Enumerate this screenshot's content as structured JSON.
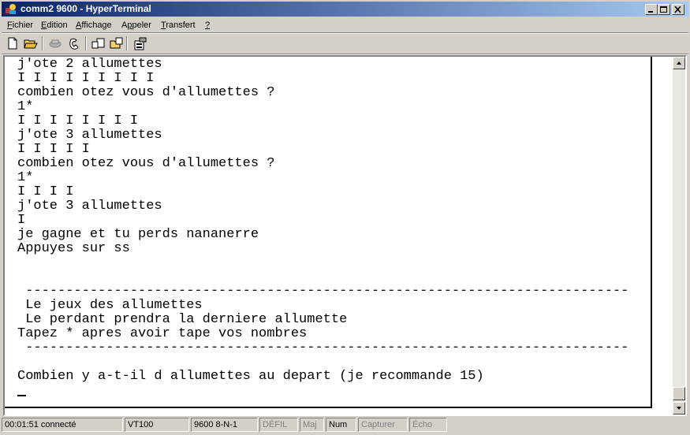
{
  "window": {
    "title": "comm2 9600 - HyperTerminal"
  },
  "menu": {
    "items": [
      {
        "pre": "",
        "u": "F",
        "post": "ichier"
      },
      {
        "pre": "",
        "u": "E",
        "post": "dition"
      },
      {
        "pre": "",
        "u": "A",
        "post": "ffichage"
      },
      {
        "pre": "A",
        "u": "p",
        "post": "peler"
      },
      {
        "pre": "",
        "u": "T",
        "post": "ransfert"
      },
      {
        "pre": "",
        "u": "?",
        "post": ""
      }
    ]
  },
  "toolbar": {
    "icons": [
      "new-file-icon",
      "open-folder-icon",
      "connect-icon",
      "disconnect-icon",
      "send-file-icon",
      "receive-file-icon",
      "properties-icon"
    ]
  },
  "terminal": {
    "lines": [
      "j'ote 2 allumettes",
      "I I I I I I I I I",
      "combien otez vous d'allumettes ?",
      "1*",
      "I I I I I I I I",
      "j'ote 3 allumettes",
      "I I I I I",
      "combien otez vous d'allumettes ?",
      "1*",
      "I I I I",
      "j'ote 3 allumettes",
      "I",
      "je gagne et tu perds nananerre",
      "Appuyes sur ss",
      "",
      "",
      " ---------------------------------------------------------------------------",
      " Le jeux des allumettes",
      " Le perdant prendra la derniere allumette",
      "Tapez * apres avoir tape vos nombres",
      " ---------------------------------------------------------------------------",
      "",
      "Combien y a-t-il d allumettes au depart (je recommande 15)"
    ]
  },
  "statusbar": {
    "cells": [
      {
        "text": "00:01:51 connecté",
        "dim": false
      },
      {
        "text": "VT100",
        "dim": false
      },
      {
        "text": "9600 8-N-1",
        "dim": false
      },
      {
        "text": "DÉFIL",
        "dim": true
      },
      {
        "text": "Maj",
        "dim": true
      },
      {
        "text": "Num",
        "dim": false
      },
      {
        "text": "Capturer",
        "dim": true
      },
      {
        "text": "Écho",
        "dim": true
      }
    ]
  }
}
